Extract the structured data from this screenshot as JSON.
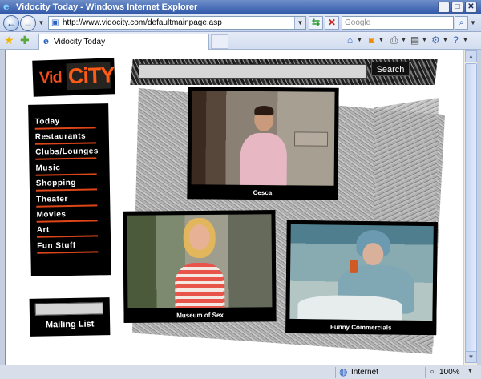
{
  "window": {
    "title": "Vidocity Today - Windows Internet Explorer"
  },
  "address": {
    "url": "http://www.vidocity.com/defaultmainpage.asp",
    "search_placeholder": "Google"
  },
  "tab": {
    "label": "Vidocity Today"
  },
  "site": {
    "logo_vid": "Vid",
    "logo_city": "CiTY",
    "search_button": "Search",
    "nav": [
      {
        "label": "Today"
      },
      {
        "label": "Restaurants"
      },
      {
        "label": "Clubs/Lounges"
      },
      {
        "label": "Music"
      },
      {
        "label": "Shopping"
      },
      {
        "label": "Theater"
      },
      {
        "label": "Movies"
      },
      {
        "label": "Art"
      },
      {
        "label": "Fun Stuff"
      }
    ],
    "videos": [
      {
        "caption": "Cesca"
      },
      {
        "caption": "Museum of Sex"
      },
      {
        "caption": "Funny Commercials"
      }
    ],
    "mailing_list": "Mailing List"
  },
  "status": {
    "zone": "Internet",
    "zoom": "100%"
  },
  "colors": {
    "accent": "#e04518",
    "titlebar": "#2f56a8"
  }
}
